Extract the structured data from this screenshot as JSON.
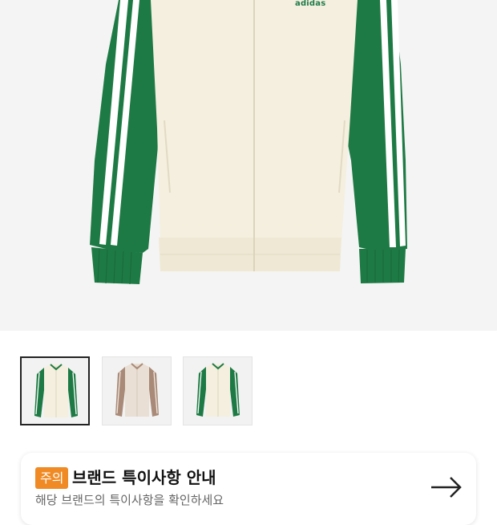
{
  "product": {
    "brand_print": "adidas",
    "colors": {
      "body": "#f4efdf",
      "sleeve": "#1e7a44",
      "stripe": "#ffffff",
      "background": "#f4f4f4"
    }
  },
  "thumbnails": [
    {
      "name": "green-cream-jacket",
      "selected": true
    },
    {
      "name": "beige-brown-jacket",
      "selected": false
    },
    {
      "name": "green-cream-jacket-alt",
      "selected": false
    }
  ],
  "notice": {
    "badge": "주의",
    "title": "브랜드 특이사항 안내",
    "subtitle": "해당 브랜드의 특이사항을 확인하세요",
    "accent": "#f08a24"
  }
}
